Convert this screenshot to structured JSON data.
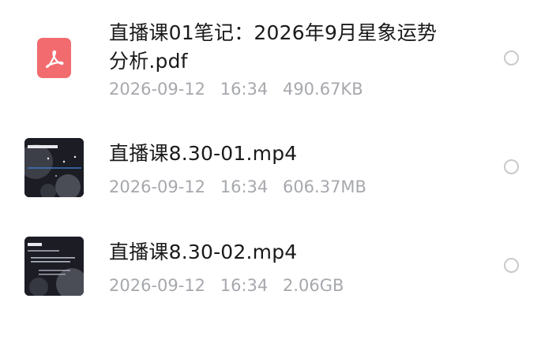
{
  "files": [
    {
      "name": "直播课01笔记：2026年9月星象运势分析.pdf",
      "date": "2026-09-12",
      "time": "16:34",
      "size": "490.67KB",
      "icon": "pdf-icon"
    },
    {
      "name": "直播课8.30-01.mp4",
      "date": "2026-09-12",
      "time": "16:34",
      "size": "606.37MB",
      "icon": "video-thumbnail"
    },
    {
      "name": "直播课8.30-02.mp4",
      "date": "2026-09-12",
      "time": "16:34",
      "size": "2.06GB",
      "icon": "video-thumbnail"
    }
  ],
  "colors": {
    "pdf_icon": "#f26b6f",
    "name_text": "#1a1a1a",
    "meta_text": "#a6a8ad",
    "radio_border": "#c8c9cc"
  }
}
